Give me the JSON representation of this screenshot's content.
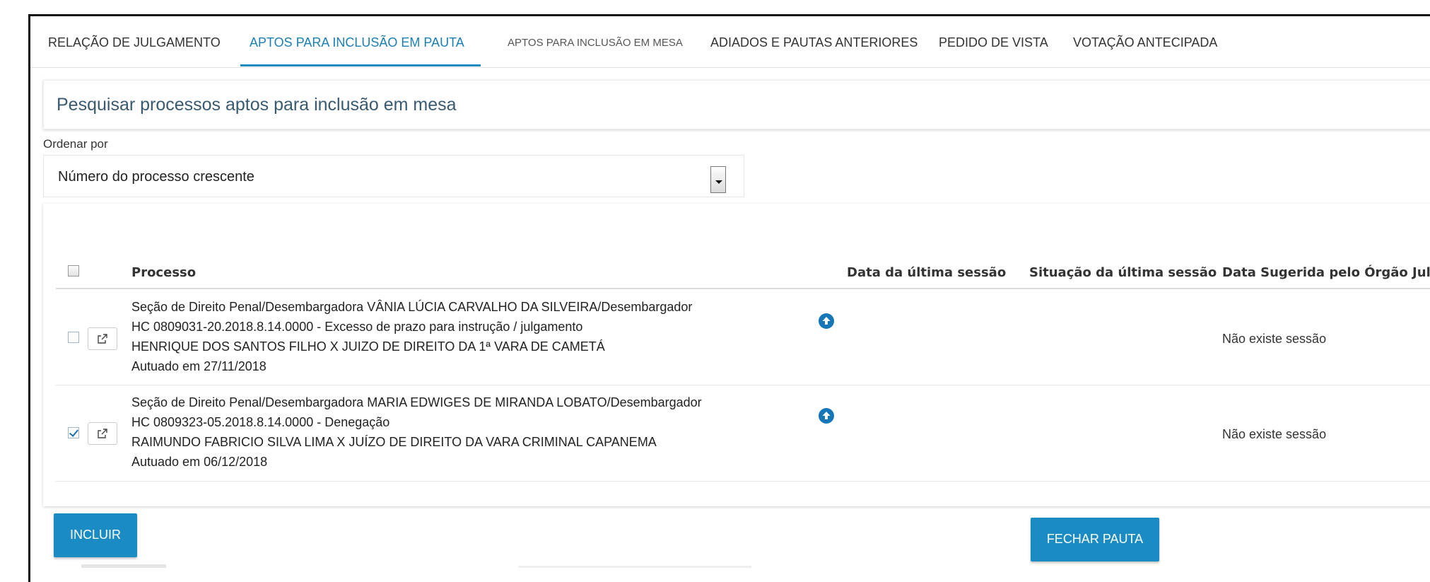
{
  "tabs": [
    {
      "label": "RELAÇÃO DE JULGAMENTO"
    },
    {
      "label": "APTOS PARA INCLUSÃO  EM PAUTA"
    },
    {
      "label": "APTOS PARA INCLUSÃO EM MESA"
    },
    {
      "label": "ADIADOS E PAUTAS ANTERIORES"
    },
    {
      "label": "PEDIDO DE VISTA"
    },
    {
      "label": "VOTAÇÃO ANTECIPADA"
    }
  ],
  "search": {
    "title": "Pesquisar processos aptos para inclusão em mesa"
  },
  "order": {
    "label": "Ordenar por",
    "selected": "Número do processo crescente"
  },
  "table": {
    "headers": {
      "processo": "Processo",
      "data_ultima": "Data da última sessão",
      "situacao": "Situação da última sessão",
      "data_sugerida": "Data Sugerida pelo Órgão Julgador"
    },
    "rows": [
      {
        "checked": false,
        "lines": [
          "Seção de Direito Penal/Desembargadora VÂNIA LÚCIA CARVALHO DA SILVEIRA/Desembargador",
          "HC 0809031-20.2018.8.14.0000 - Excesso de prazo para instrução / julgamento",
          "HENRIQUE DOS SANTOS FILHO X JUIZO DE DIREITO DA 1ª VARA DE CAMETÁ",
          "Autuado em 27/11/2018"
        ],
        "status": "Não existe sessão"
      },
      {
        "checked": true,
        "lines": [
          "Seção de Direito Penal/Desembargadora MARIA EDWIGES DE MIRANDA LOBATO/Desembargador",
          "HC 0809323-05.2018.8.14.0000 - Denegação",
          "RAIMUNDO FABRICIO SILVA LIMA X JUÍZO DE DIREITO DA VARA CRIMINAL CAPANEMA",
          "Autuado em 06/12/2018"
        ],
        "status": "Não existe sessão"
      }
    ]
  },
  "buttons": {
    "incluir": "INCLUIR",
    "fechar_pauta": "FECHAR PAUTA"
  },
  "colors": {
    "accent": "#1a8cc3",
    "active_tab": "#1a7fb5",
    "title": "#3a5a70"
  },
  "icons": {
    "external": "external-link-icon",
    "up": "arrow-up-circle-icon"
  }
}
